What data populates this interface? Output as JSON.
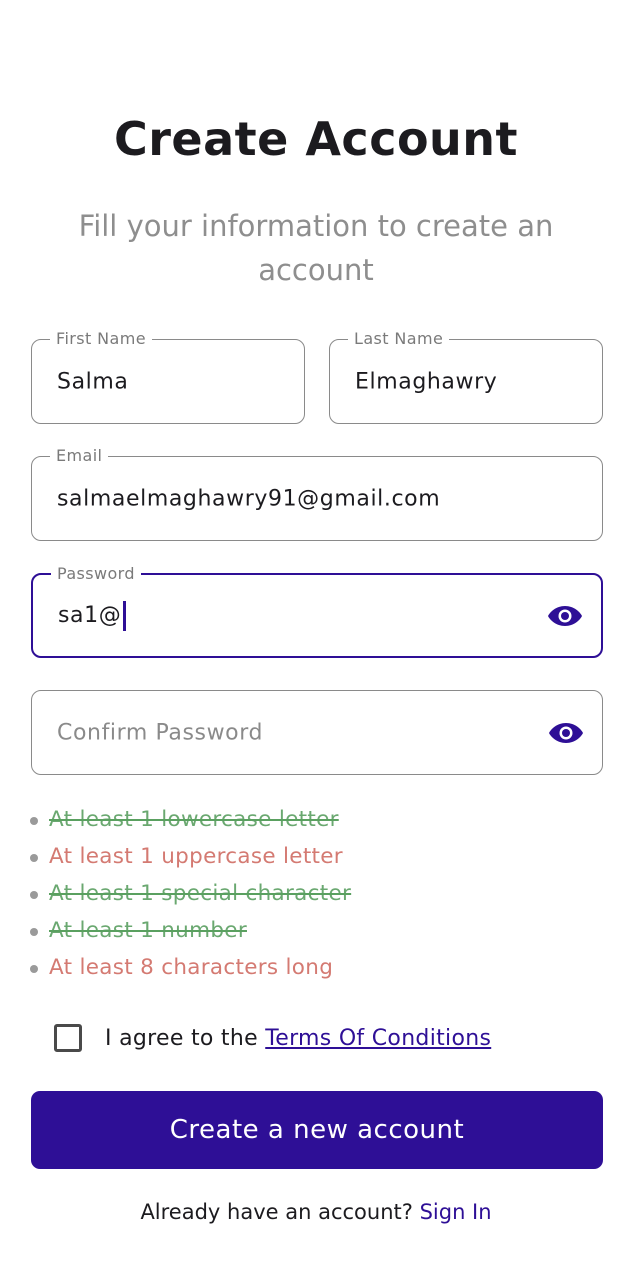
{
  "header": {
    "title": "Create Account",
    "subtitle": "Fill your information to create an account"
  },
  "form": {
    "first_name": {
      "label": "First Name",
      "value": "Salma"
    },
    "last_name": {
      "label": "Last Name",
      "value": "Elmaghawry"
    },
    "email": {
      "label": "Email",
      "value": "salmaelmaghawry91@gmail.com"
    },
    "password": {
      "label": "Password",
      "value": "sa1@",
      "focused": true,
      "toggle_icon": "eye-icon"
    },
    "confirm_password": {
      "placeholder": "Confirm Password",
      "value": "",
      "toggle_icon": "eye-icon"
    }
  },
  "password_rules": [
    {
      "text": "At least 1 lowercase letter",
      "met": true
    },
    {
      "text": "At least 1 uppercase letter",
      "met": false
    },
    {
      "text": "At least 1 special character",
      "met": true
    },
    {
      "text": "At least 1 number",
      "met": true
    },
    {
      "text": "At least 8 characters long",
      "met": false
    }
  ],
  "agreement": {
    "checked": false,
    "prefix": "I agree to the ",
    "link_label": "Terms Of Conditions"
  },
  "actions": {
    "create_label": "Create a new account"
  },
  "footer": {
    "prompt": "Already have an account? ",
    "sign_in_label": "Sign In"
  },
  "colors": {
    "primary": "#2e0f96",
    "rule_met": "#6aa870",
    "rule_unmet": "#d47a72",
    "field_border": "#8a8a8a"
  }
}
